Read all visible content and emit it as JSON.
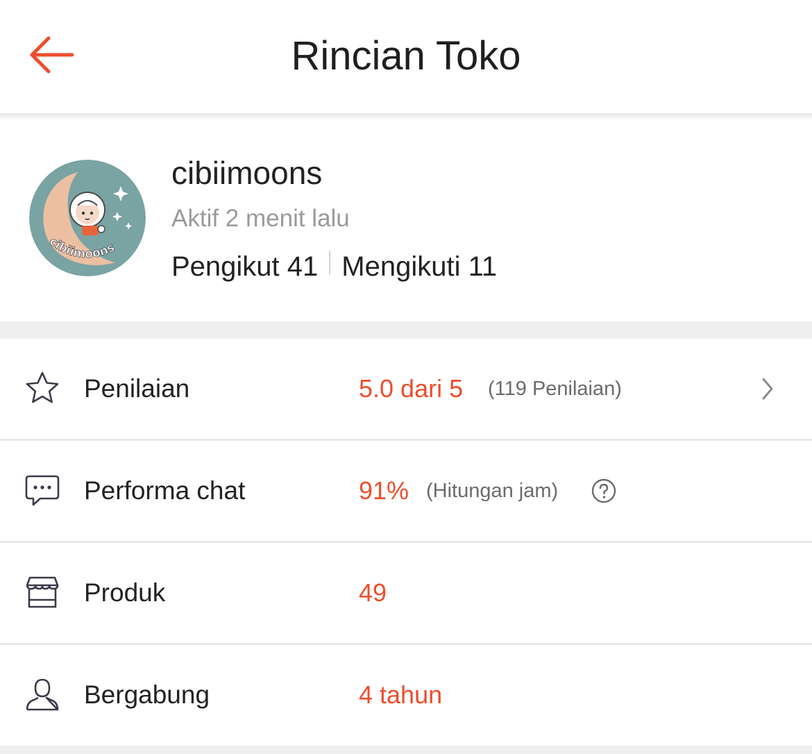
{
  "header": {
    "title": "Rincian Toko",
    "back_icon": "arrow-left-icon",
    "accent_color": "#ee4d2d"
  },
  "profile": {
    "avatar_text": "cibiimoons",
    "name": "cibiimoons",
    "active_status": "Aktif 2 menit lalu",
    "followers": "Pengikut 41",
    "following": "Mengikuti 11"
  },
  "stats": [
    {
      "icon": "star-icon",
      "label": "Penilaian",
      "value": "5.0 dari 5",
      "note": "(119 Penilaian)",
      "trailing_icon": "chevron-right-icon"
    },
    {
      "icon": "chat-bubble-icon",
      "label": "Performa chat",
      "value": "91%",
      "note": "(Hitungan jam)",
      "trailing_icon": "question-circle-icon"
    },
    {
      "icon": "storefront-icon",
      "label": "Produk",
      "value": "49"
    },
    {
      "icon": "user-icon",
      "label": "Bergabung",
      "value": "4 tahun"
    }
  ]
}
